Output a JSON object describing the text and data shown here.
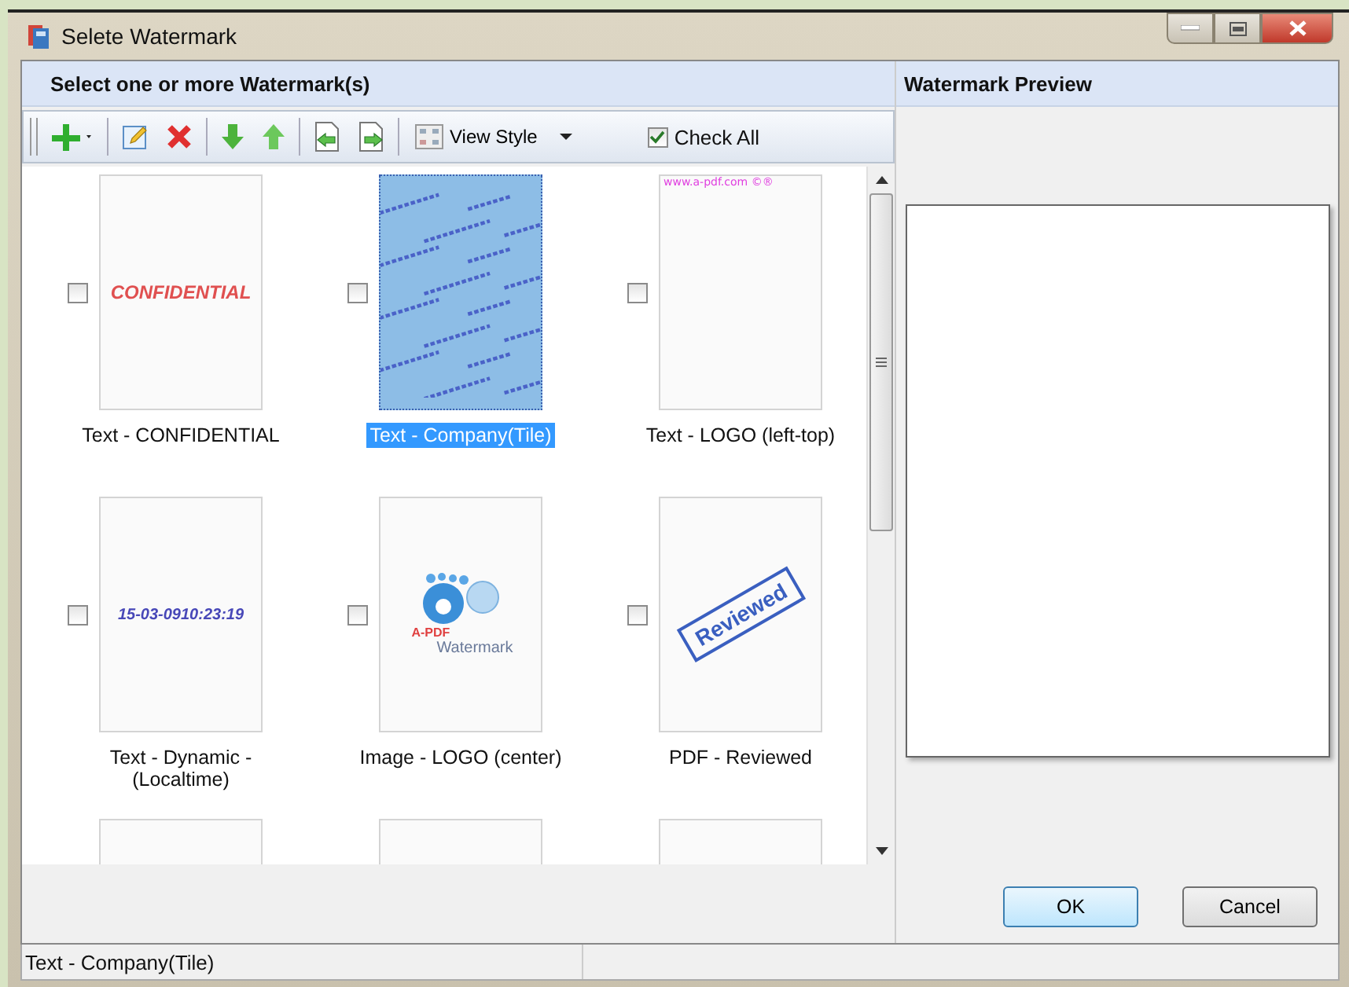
{
  "window": {
    "title": "Selete Watermark"
  },
  "left_panel": {
    "header": "Select one or more Watermark(s)"
  },
  "toolbar": {
    "view_style": "View Style",
    "check_all": {
      "label": "Check All",
      "checked": true
    }
  },
  "items": [
    {
      "kind": "text",
      "label": "Text - CONFIDENTIAL",
      "thumb_text": "CONFIDENTIAL",
      "checked": false,
      "selected": false
    },
    {
      "kind": "tile",
      "label": "Text - Company(Tile)",
      "checked": false,
      "selected": true
    },
    {
      "kind": "corner",
      "label": "Text - LOGO (left-top)",
      "thumb_text": "www.a-pdf.com ©®",
      "checked": false,
      "selected": false
    },
    {
      "kind": "dynamic",
      "label": "Text - Dynamic - (Localtime)",
      "thumb_text": "15-03-0910:23:19",
      "checked": false,
      "selected": false
    },
    {
      "kind": "image",
      "label": "Image - LOGO (center)",
      "thumb_text": "A-PDF",
      "thumb_text_2": "Watermark",
      "checked": false,
      "selected": false
    },
    {
      "kind": "stamp",
      "label": "PDF - Reviewed",
      "thumb_text": "Reviewed",
      "checked": false,
      "selected": false
    },
    {
      "kind": "blank"
    },
    {
      "kind": "blank"
    },
    {
      "kind": "blank"
    }
  ],
  "right_panel": {
    "header": "Watermark Preview"
  },
  "buttons": [
    {
      "label": "OK",
      "default": true
    },
    {
      "label": "Cancel",
      "default": false
    }
  ],
  "status_bar": "Text - Company(Tile)"
}
